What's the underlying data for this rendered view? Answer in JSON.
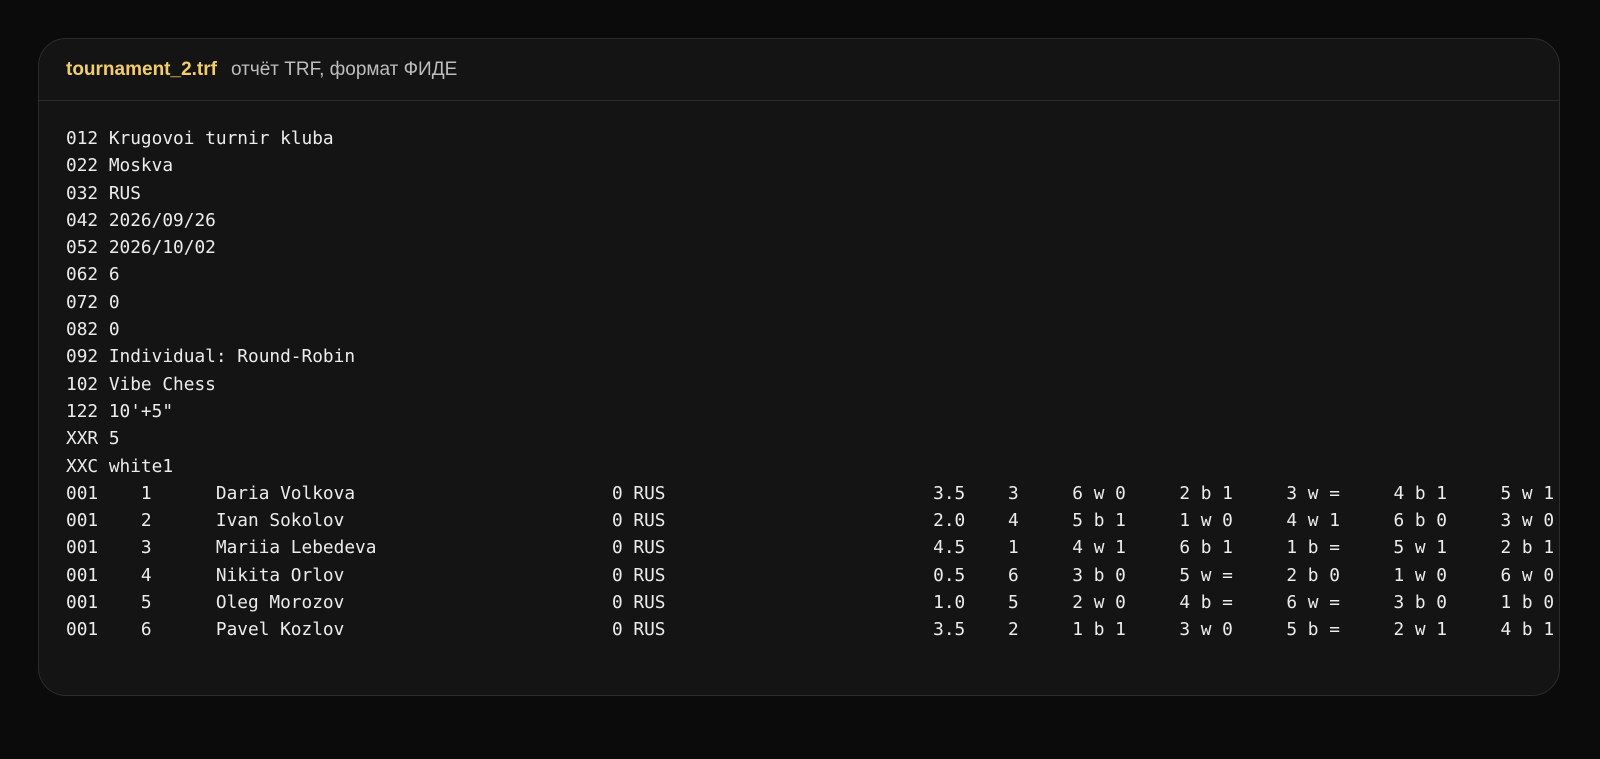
{
  "header": {
    "filename": "tournament_2.trf",
    "subtitle": "отчёт TRF, формат ФИДЕ"
  },
  "lines": [
    "012 Krugovoi turnir kluba",
    "022 Moskva",
    "032 RUS",
    "042 2026/09/26",
    "052 2026/10/02",
    "062 6",
    "072 0",
    "082 0",
    "092 Individual: Round-Robin",
    "102 Vibe Chess",
    "122 10'+5\"",
    "XXR 5",
    "XXC white1",
    "001    1      Daria Volkova                        0 RUS                         3.5    3     6 w 0     2 b 1     3 w =     4 b 1     5 w 1",
    "001    2      Ivan Sokolov                         0 RUS                         2.0    4     5 b 1     1 w 0     4 w 1     6 b 0     3 w 0",
    "001    3      Mariia Lebedeva                      0 RUS                         4.5    1     4 w 1     6 b 1     1 b =     5 w 1     2 b 1",
    "001    4      Nikita Orlov                         0 RUS                         0.5    6     3 b 0     5 w =     2 b 0     1 w 0     6 w 0",
    "001    5      Oleg Morozov                         0 RUS                         1.0    5     2 w 0     4 b =     6 w =     3 b 0     1 b 0",
    "001    6      Pavel Kozlov                         0 RUS                         3.5    2     1 b 1     3 w 0     5 b =     2 w 1     4 b 1"
  ]
}
